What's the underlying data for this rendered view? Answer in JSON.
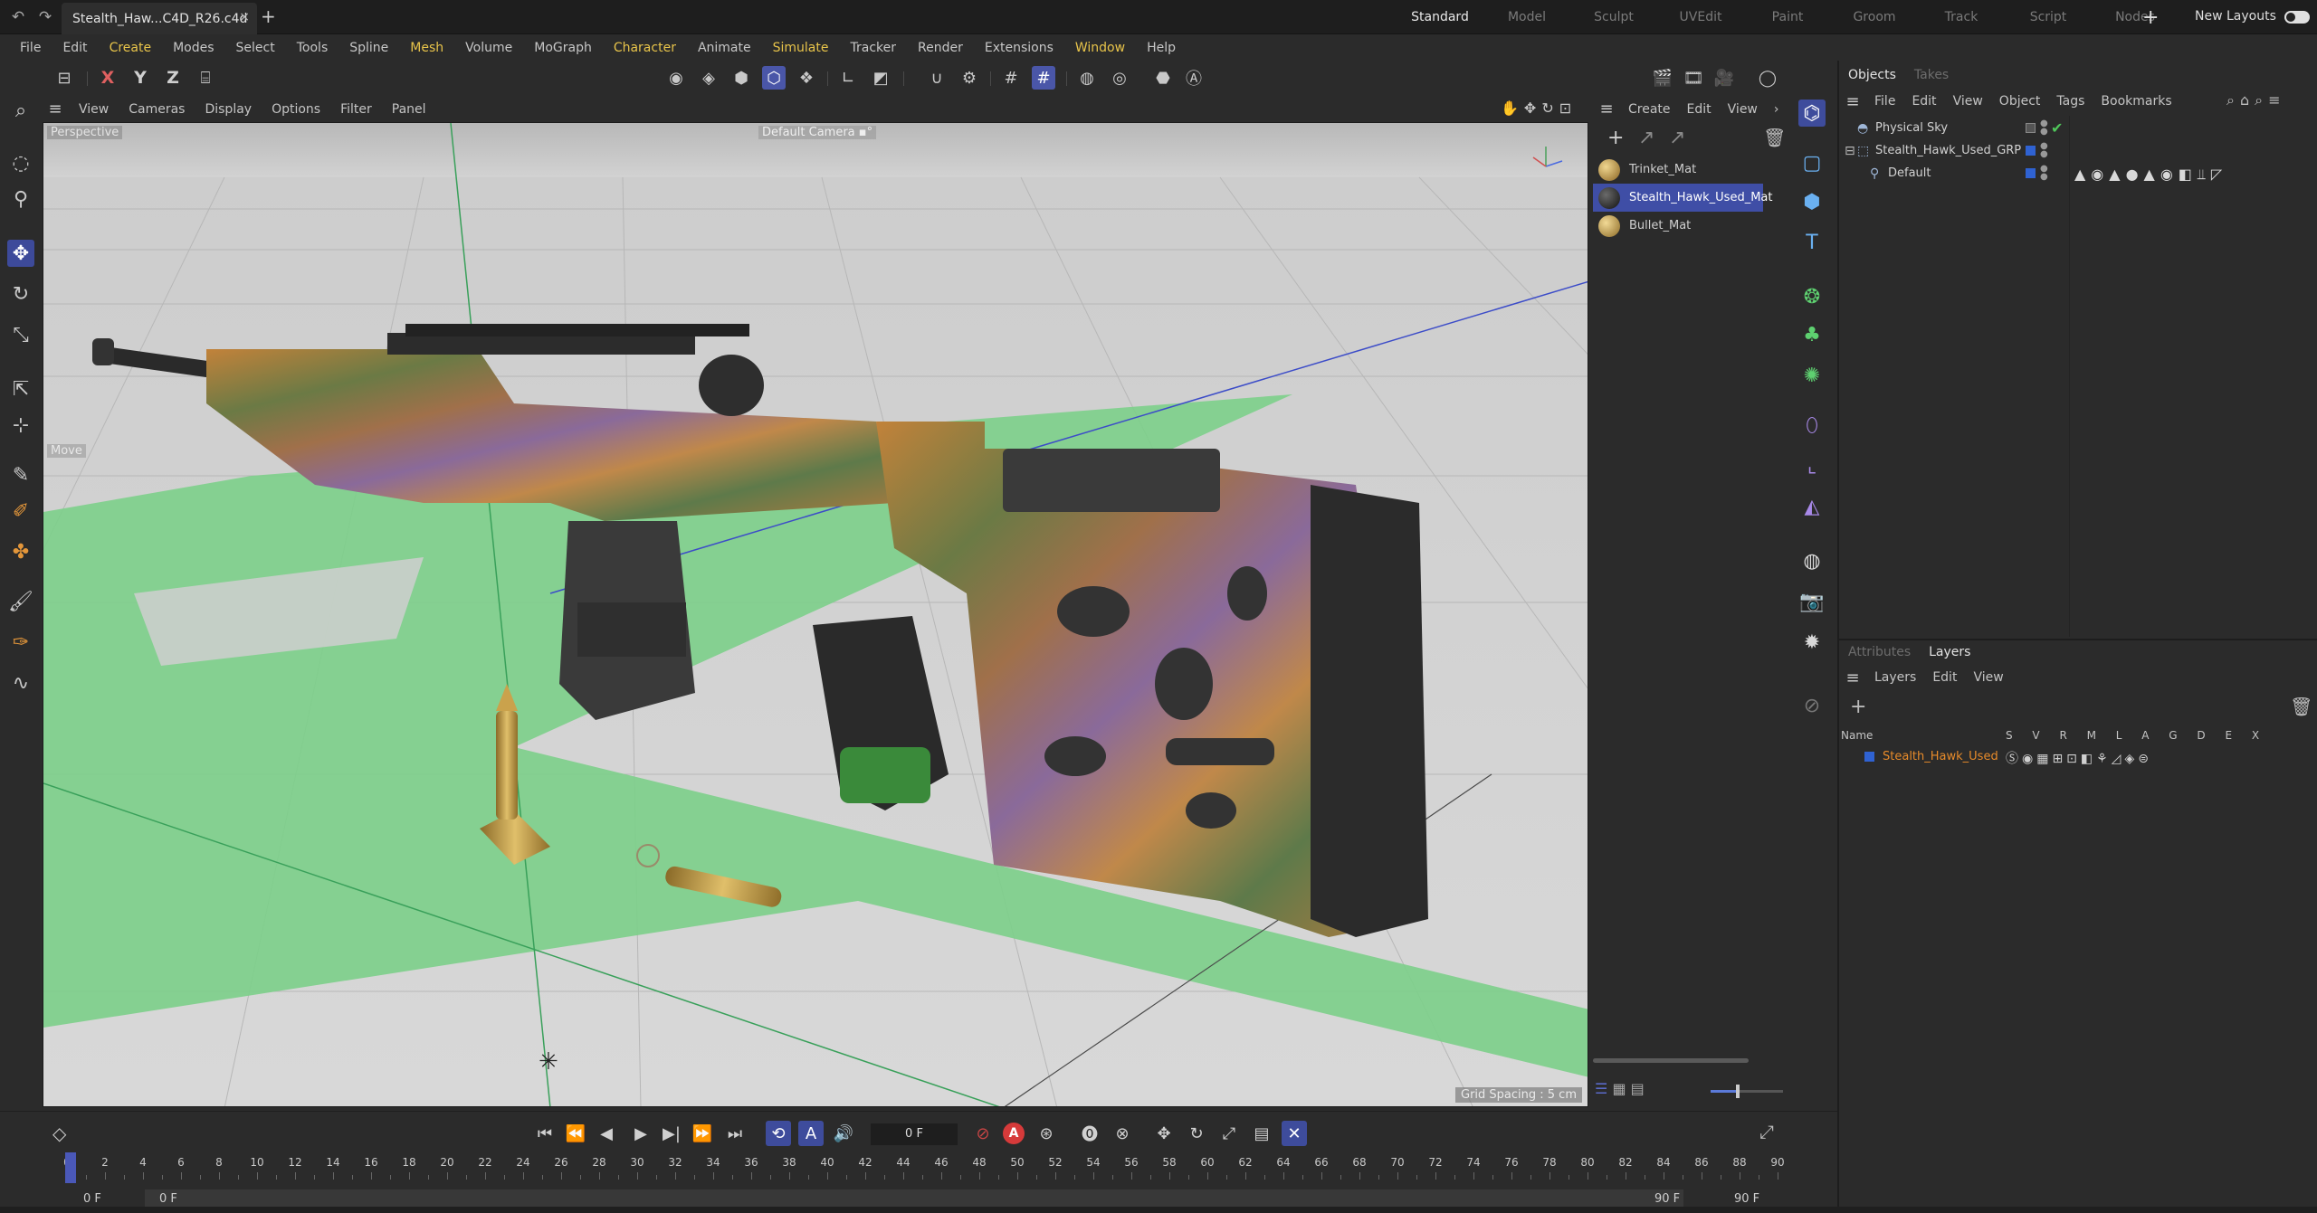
{
  "tabbar": {
    "document_tab": "Stealth_Haw...C4D_R26.c4d",
    "close_glyph": "×",
    "add_glyph": "+",
    "undo_icon": "undo-icon",
    "redo_icon": "redo-icon",
    "layouts": [
      "Standard",
      "Model",
      "Sculpt",
      "UVEdit",
      "Paint",
      "Groom",
      "Track",
      "Script",
      "Nodes"
    ],
    "active_layout": "Standard",
    "new_layouts": "New Layouts"
  },
  "menubar": {
    "items": [
      "File",
      "Edit",
      "Create",
      "Modes",
      "Select",
      "Tools",
      "Spline",
      "Mesh",
      "Volume",
      "MoGraph",
      "Character",
      "Animate",
      "Simulate",
      "Tracker",
      "Render",
      "Extensions",
      "Window",
      "Help"
    ],
    "highlighted": [
      "Create",
      "Mesh",
      "Character",
      "Simulate",
      "Window"
    ]
  },
  "toolbar": {
    "x_label": "X",
    "y_label": "Y",
    "z_label": "Z"
  },
  "viewport": {
    "menu": [
      "View",
      "Cameras",
      "Display",
      "Options",
      "Filter",
      "Panel"
    ],
    "perspective_label": "Perspective",
    "camera_label": "Default Camera",
    "camera_suffix": " ▪°",
    "move_label": "Move",
    "grid_spacing": "Grid Spacing : 5 cm"
  },
  "material_manager": {
    "menu": [
      "Create",
      "Edit",
      "View"
    ],
    "materials": [
      {
        "name": "Trinket_Mat",
        "selected": false,
        "color": "#b08a3c"
      },
      {
        "name": "Stealth_Hawk_Used_Mat",
        "selected": true,
        "color": "#3a3a3a"
      },
      {
        "name": "Bullet_Mat",
        "selected": false,
        "color": "#b69040"
      }
    ]
  },
  "object_manager": {
    "tabs": [
      "Objects",
      "Takes"
    ],
    "active_tab": "Objects",
    "menu": [
      "File",
      "Edit",
      "View",
      "Object",
      "Tags",
      "Bookmarks"
    ],
    "objects": [
      {
        "name": "Physical Sky",
        "icon": "sky-icon",
        "indent": 0
      },
      {
        "name": "Stealth_Hawk_Used_GRP",
        "icon": "null-group-icon",
        "indent": 0
      },
      {
        "name": "Default",
        "icon": "joint-icon",
        "indent": 1
      }
    ]
  },
  "layer_manager": {
    "tabs": [
      "Attributes",
      "Layers"
    ],
    "active_tab": "Layers",
    "menu": [
      "Layers",
      "Edit",
      "View"
    ],
    "col_name": "Name",
    "col_flags": "S V R M L A G D E X",
    "layers": [
      {
        "name": "Stealth_Hawk_Used",
        "color": "#2f62d2"
      }
    ]
  },
  "timeline": {
    "current_frame": "0 F",
    "ruler_labels": [
      "0",
      "2",
      "4",
      "6",
      "8",
      "10",
      "12",
      "14",
      "16",
      "18",
      "20",
      "22",
      "24",
      "26",
      "28",
      "30",
      "32",
      "34",
      "36",
      "38",
      "40",
      "42",
      "44",
      "46",
      "48",
      "50",
      "52",
      "54",
      "56",
      "58",
      "60",
      "62",
      "64",
      "66",
      "68",
      "70",
      "72",
      "74",
      "76",
      "78",
      "80",
      "82",
      "84",
      "86",
      "88",
      "90"
    ],
    "range_start": "0 F",
    "range_start_inner": "0 F",
    "range_end_inner": "90 F",
    "range_end": "90 F",
    "record_auto_label": "A"
  },
  "colors": {
    "accent": "#4a56a8",
    "highlight_menu": "#e8c44a",
    "layer_name": "#e88b2a",
    "grid_plane": "#7ccf8a"
  }
}
